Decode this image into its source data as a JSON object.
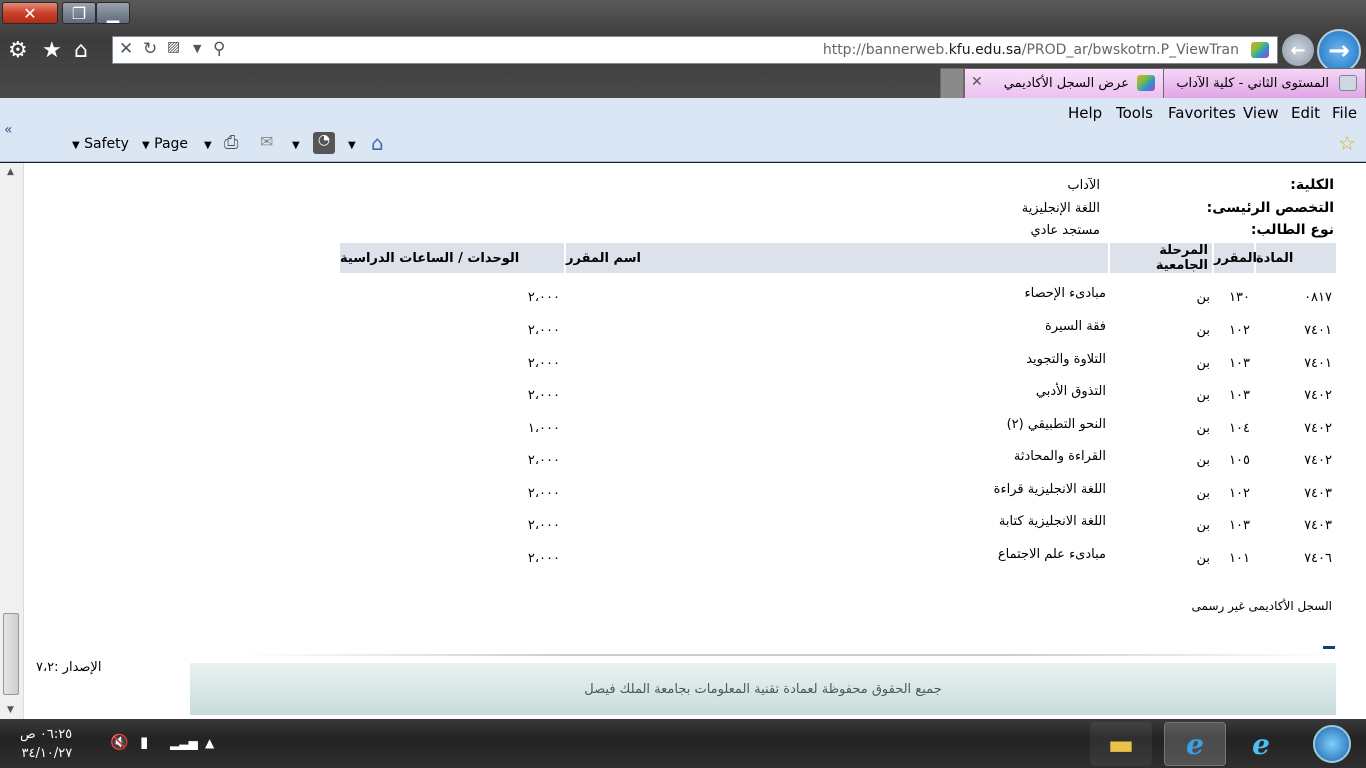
{
  "browser": {
    "url_prefix": "http://bannerweb.",
    "url_domain": "kfu.edu.sa",
    "url_suffix": "/PROD_ar/bwskotrn.P_ViewTran",
    "tabs": [
      {
        "label": "المستوى الثاني - كلية الآداب"
      },
      {
        "label": "عرض السجل الأكاديمي"
      }
    ],
    "menu": [
      "File",
      "Edit",
      "View",
      "Favorites",
      "Tools",
      "Help"
    ],
    "commands": {
      "page": "Page",
      "safety": "Safety",
      "chevron": "«"
    }
  },
  "student_info": [
    {
      "label": "الكلية:",
      "value": "الآداب"
    },
    {
      "label": "التخصص الرئيسى:",
      "value": "اللغة الإنجليزية"
    },
    {
      "label": "نوع الطالب:",
      "value": "مستجد عادي"
    }
  ],
  "table": {
    "headers": {
      "subject": "المادة",
      "course": "المقرر",
      "level": "المرحلة الجامعية",
      "name": "اسم المقرر",
      "units": "الوحدات / الساعات الدراسية"
    },
    "rows": [
      {
        "subject": "٠٨١٧",
        "course": "١٣٠",
        "level": "بن",
        "name": "مبادىء الإحصاء",
        "units": "٢،٠٠٠"
      },
      {
        "subject": "٧٤٠١",
        "course": "١٠٢",
        "level": "بن",
        "name": "فقة السيرة",
        "units": "٢،٠٠٠"
      },
      {
        "subject": "٧٤٠١",
        "course": "١٠٣",
        "level": "بن",
        "name": "التلاوة والتجويد",
        "units": "٢،٠٠٠"
      },
      {
        "subject": "٧٤٠٢",
        "course": "١٠٣",
        "level": "بن",
        "name": "التذوق الأدبي",
        "units": "٢،٠٠٠"
      },
      {
        "subject": "٧٤٠٢",
        "course": "١٠٤",
        "level": "بن",
        "name": "النحو التطبيقي (٢)",
        "units": "١،٠٠٠"
      },
      {
        "subject": "٧٤٠٢",
        "course": "١٠٥",
        "level": "بن",
        "name": "القراءة والمحادثة",
        "units": "٢،٠٠٠"
      },
      {
        "subject": "٧٤٠٣",
        "course": "١٠٢",
        "level": "بن",
        "name": "اللغة الانجليزية قراءة",
        "units": "٢،٠٠٠"
      },
      {
        "subject": "٧٤٠٣",
        "course": "١٠٣",
        "level": "بن",
        "name": "اللغة الانجليزية كتابة",
        "units": "٢،٠٠٠"
      },
      {
        "subject": "٧٤٠٦",
        "course": "١٠١",
        "level": "بن",
        "name": "مبادىء علم الاجتماع",
        "units": "٢،٠٠٠"
      }
    ]
  },
  "note": "السجل الأكاديمى غير رسمى",
  "version": "الإصدار :٧،٢",
  "footer": "جميع الحقوق محفوظة لعمادة تقنية المعلومات بجامعة الملك فيصل",
  "taskbar": {
    "time": "٠٦:٢٥ ص",
    "date": "٣٤/١٠/٢٧"
  },
  "colors": {
    "header_bg": "#dde2ea",
    "menubar_bg": "#dbe6f4",
    "footer_bg": "#c7dcdc"
  }
}
